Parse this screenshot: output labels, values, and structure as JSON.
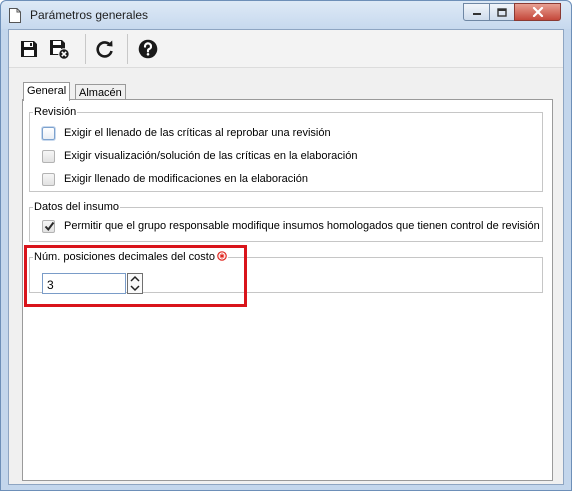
{
  "window": {
    "title": "Parámetros generales",
    "controls": [
      "minimize",
      "maximize",
      "close"
    ]
  },
  "toolbar": {
    "buttons": [
      {
        "icon": "save-icon",
        "tooltip": ""
      },
      {
        "icon": "save-close-icon",
        "tooltip": ""
      },
      {
        "icon": "refresh-icon",
        "tooltip": ""
      },
      {
        "icon": "help-icon",
        "tooltip": ""
      }
    ]
  },
  "tabs": [
    {
      "label": "General",
      "active": true
    },
    {
      "label": "Almacén",
      "active": false
    }
  ],
  "revision": {
    "legend": "Revisión",
    "options": [
      {
        "label": "Exigir el llenado de las críticas al reprobar una revisión",
        "checked": false
      },
      {
        "label": "Exigir visualización/solución de las críticas en la elaboración",
        "checked": false
      },
      {
        "label": "Exigir llenado de modificaciones en la elaboración",
        "checked": false
      }
    ]
  },
  "insumo": {
    "legend": "Datos del insumo",
    "options": [
      {
        "label": "Permitir que el grupo responsable modifique insumos homologados que tienen control de revisión",
        "checked": true
      }
    ]
  },
  "decimales": {
    "legend": "Núm. posiciones decimales del costo",
    "required": true,
    "value": "3"
  },
  "colors": {
    "highlight": "#d9141b",
    "required": "#e0261f"
  }
}
